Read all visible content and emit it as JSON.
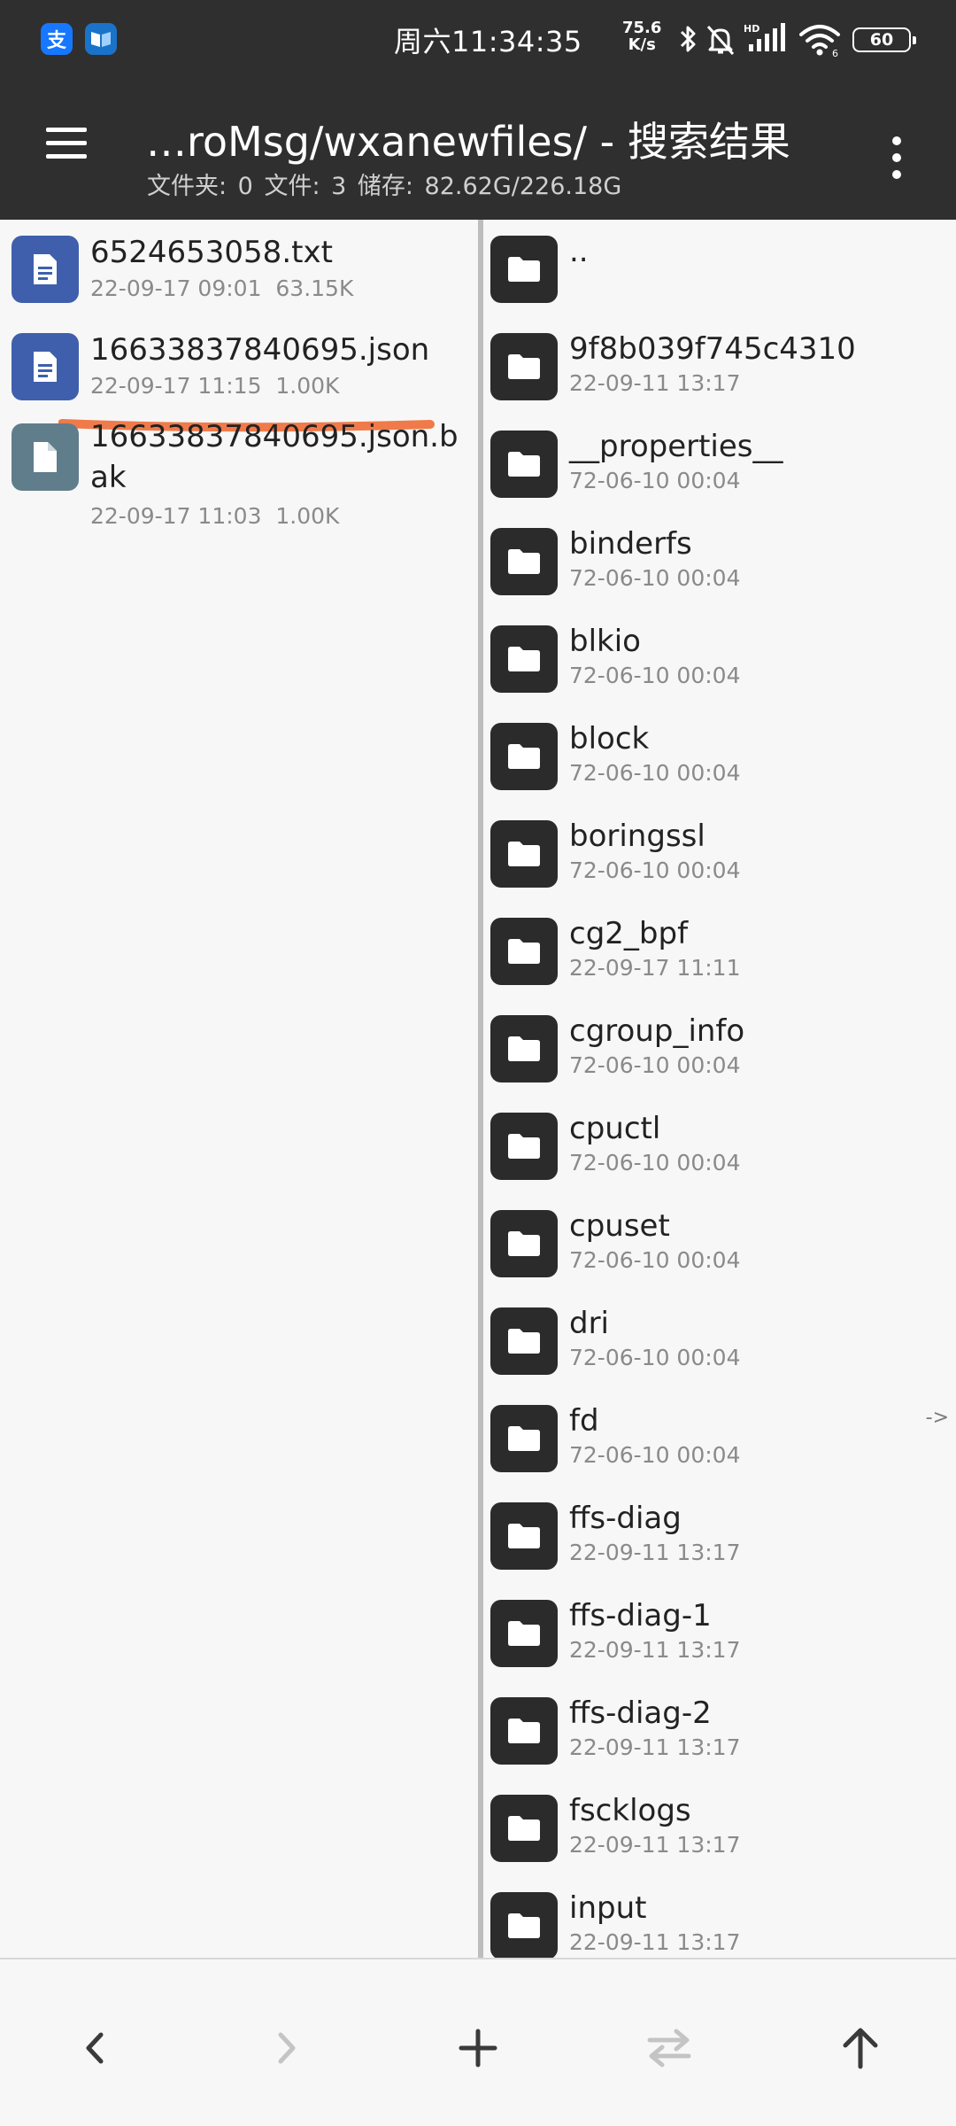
{
  "status_bar": {
    "time": "周六11:34:35",
    "net_speed_value": "75.6",
    "net_speed_unit": "K/s",
    "battery": "60",
    "apps": [
      {
        "icon": "alipay-icon",
        "glyph": "支",
        "color": "#1677ff"
      },
      {
        "icon": "reader-app-icon",
        "glyph": "",
        "color": "#1a73c8"
      }
    ],
    "icons": [
      "bluetooth-icon",
      "mute-icon",
      "hd-signal-icon",
      "wifi-icon",
      "battery-icon"
    ]
  },
  "app_bar": {
    "title": "…roMsg/wxanewfiles/ - 搜索结果",
    "subtitle": "文件夹: 0   文件: 3   储存: 82.62G/226.18G",
    "menu_icon": "hamburger-menu-icon",
    "more_icon": "more-vert-icon"
  },
  "left_pane": {
    "files": [
      {
        "name": "6524653058.txt",
        "date": "22-09-17 09:01",
        "size": "63.15K",
        "icon": "text-file-icon",
        "color": "#3f5fad"
      },
      {
        "name": "16633837840695.json",
        "date": "22-09-17 11:15",
        "size": "1.00K",
        "icon": "text-file-icon",
        "color": "#3f5fad",
        "highlighted": true
      },
      {
        "name": "16633837840695.json.bak",
        "date": "22-09-17 11:03",
        "size": "1.00K",
        "icon": "generic-file-icon",
        "color": "#607d8b"
      }
    ],
    "annotation_color": "#f07a4a"
  },
  "right_pane": {
    "folders": [
      {
        "name": "..",
        "date": ""
      },
      {
        "name": "9f8b039f745c4310",
        "date": "22-09-11 13:17"
      },
      {
        "name": "__properties__",
        "date": "72-06-10 00:04"
      },
      {
        "name": "binderfs",
        "date": "72-06-10 00:04"
      },
      {
        "name": "blkio",
        "date": "72-06-10 00:04"
      },
      {
        "name": "block",
        "date": "72-06-10 00:04"
      },
      {
        "name": "boringssl",
        "date": "72-06-10 00:04"
      },
      {
        "name": "cg2_bpf",
        "date": "22-09-17 11:11"
      },
      {
        "name": "cgroup_info",
        "date": "72-06-10 00:04"
      },
      {
        "name": "cpuctl",
        "date": "72-06-10 00:04"
      },
      {
        "name": "cpuset",
        "date": "72-06-10 00:04"
      },
      {
        "name": "dri",
        "date": "72-06-10 00:04"
      },
      {
        "name": "fd",
        "date": "72-06-10 00:04",
        "link": "->"
      },
      {
        "name": "ffs-diag",
        "date": "22-09-11 13:17"
      },
      {
        "name": "ffs-diag-1",
        "date": "22-09-11 13:17"
      },
      {
        "name": "ffs-diag-2",
        "date": "22-09-11 13:17"
      },
      {
        "name": "fscklogs",
        "date": "22-09-11 13:17"
      },
      {
        "name": "input",
        "date": "22-09-11 13:17"
      }
    ],
    "folder_icon": "folder-icon"
  },
  "toolbar": {
    "buttons": [
      {
        "name": "back-button",
        "icon": "chevron-left-icon",
        "enabled": true
      },
      {
        "name": "forward-button",
        "icon": "chevron-right-icon",
        "enabled": false
      },
      {
        "name": "add-button",
        "icon": "plus-icon",
        "enabled": true
      },
      {
        "name": "swap-panes-button",
        "icon": "swap-icon",
        "enabled": false
      },
      {
        "name": "up-button",
        "icon": "arrow-up-icon",
        "enabled": true
      }
    ]
  }
}
